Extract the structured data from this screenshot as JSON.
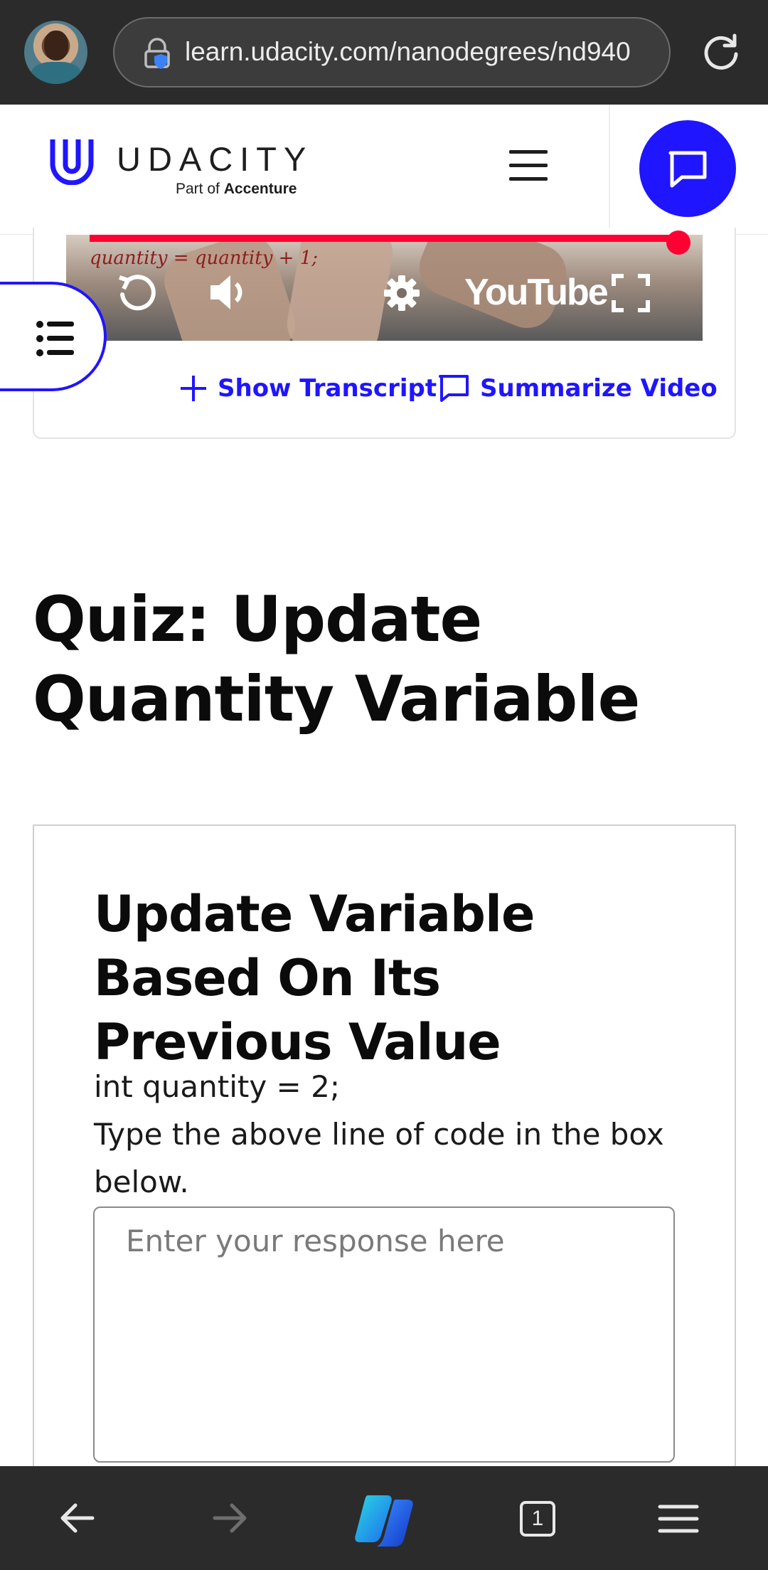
{
  "browser": {
    "url": "learn.udacity.com/nanodegrees/nd940",
    "tab_count": "1"
  },
  "header": {
    "brand": "UDACITY",
    "tagline_prefix": "Part of",
    "tagline_brand": "Accenture",
    "accent_color": "#2015ff"
  },
  "video": {
    "code_overlay": "quantity = quantity + 1;",
    "player_brand": "YouTube",
    "progress_color": "#ff0033",
    "show_transcript_label": "Show Transcript",
    "summarize_video_label": "Summarize Video"
  },
  "quiz": {
    "title": "Quiz: Update Quantity Variable",
    "heading": "Update Variable Based On Its Previous Value",
    "code_line": "int quantity = 2;",
    "instruction": "Type the above line of code in the box below.",
    "response_placeholder": "Enter your response here"
  },
  "icons": {
    "top": [
      "avatar",
      "lock-icon",
      "reload-icon"
    ],
    "header": [
      "udacity-logo-icon",
      "hamburger-menu-icon",
      "chat-icon"
    ],
    "video": [
      "replay-icon",
      "volume-icon",
      "settings-gear-icon",
      "fullscreen-icon",
      "list-icon"
    ],
    "bottom": [
      "back-arrow-icon",
      "forward-arrow-icon",
      "copilot-icon",
      "tabs-icon",
      "menu-icon"
    ]
  }
}
